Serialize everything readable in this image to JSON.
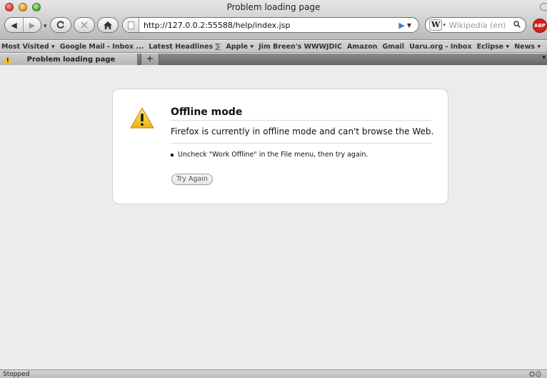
{
  "window": {
    "title": "Problem loading page"
  },
  "toolbar": {
    "url": "http://127.0.0.2:55588/help/index.jsp",
    "search_placeholder": "Wikipedia (en)",
    "search_engine_glyph": "W",
    "adblock_label": "ABP"
  },
  "bookmarks": [
    {
      "label": "Most Visited ▾"
    },
    {
      "label": "Google Mail - Inbox ..."
    },
    {
      "label": "Latest Headlines ⅀"
    },
    {
      "label": "Apple ▾"
    },
    {
      "label": "Jim Breen's WWWJDIC"
    },
    {
      "label": "Amazon"
    },
    {
      "label": "Gmail"
    },
    {
      "label": "Uaru.org - Inbox"
    },
    {
      "label": "Eclipse ▾"
    },
    {
      "label": "News ▾"
    }
  ],
  "tabs": [
    {
      "title": "Problem loading page",
      "active": true
    }
  ],
  "newtab_label": "+",
  "error": {
    "title": "Offline mode",
    "short_desc": "Firefox is currently in offline mode and can't browse the Web.",
    "suggestions": [
      "Uncheck \"Work Offline\" in the File menu, then try again."
    ],
    "button_label": "Try Again"
  },
  "status": {
    "text": "Stopped"
  },
  "colors": {
    "warning_yellow": "#f2c021",
    "abp_red": "#d4201e",
    "go_arrow_blue": "#3b7bd6"
  }
}
